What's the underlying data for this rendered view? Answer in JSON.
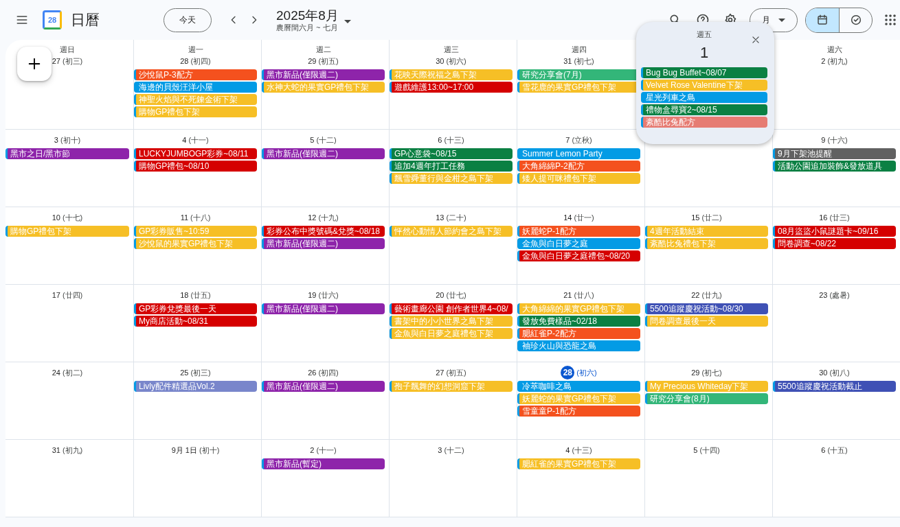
{
  "header": {
    "app_title": "日曆",
    "logo_text": "28",
    "today_button": "今天",
    "title": "2025年8月",
    "subtitle": "農曆閏六月 ~ 七月",
    "view_select": "月",
    "view_toggle": [
      {
        "kind": "calendar",
        "selected": true
      },
      {
        "kind": "tasks",
        "selected": false
      }
    ]
  },
  "weeks": [
    {
      "days": [
        {
          "weekday": "週日",
          "day": "27",
          "lunar": "(初三)"
        },
        {
          "weekday": "週一",
          "day": "28",
          "lunar": "(初四)",
          "events": [
            {
              "title": "沙悅鼠P-3配方",
              "color": "#f4511e"
            },
            {
              "title": "海邊的貝殼汪洋小屋",
              "color": "#039be5"
            },
            {
              "title": "神聖火焰與不死鍊金術下架",
              "color": "#f6bf26"
            },
            {
              "title": "購物GP禮包下架",
              "color": "#f6bf26"
            }
          ]
        },
        {
          "weekday": "週二",
          "day": "29",
          "lunar": "(初五)",
          "events": [
            {
              "title": "黑市新品(僅限週二)",
              "color": "#8e24aa"
            },
            {
              "title": "水神大蛇的果實GP禮包下架",
              "color": "#f6bf26"
            }
          ]
        },
        {
          "weekday": "週三",
          "day": "30",
          "lunar": "(初六)",
          "events": [
            {
              "title": "花映天際祝福之島下架",
              "color": "#f6bf26"
            },
            {
              "title": "遊戲維護13:00~17:00",
              "color": "#d50000"
            }
          ]
        },
        {
          "weekday": "週四",
          "day": "31",
          "lunar": "(初七)",
          "events": [
            {
              "title": "研究分享會(7月)",
              "color": "#33b679"
            },
            {
              "title": "雪花鹿的果實GP禮包下架",
              "color": "#f6bf26"
            }
          ]
        },
        {
          "kind": "covered"
        },
        {
          "weekday": "週六",
          "day": "2",
          "lunar": "(初九)"
        }
      ]
    },
    {
      "days": [
        {
          "day": "3",
          "lunar": "(初十)",
          "events": [
            {
              "title": "黑市之日/黑市節",
              "color": "#8e24aa"
            }
          ]
        },
        {
          "day": "4",
          "lunar": "(十一)",
          "events": [
            {
              "title": "LUCKYJUMBOGP彩券~08/11",
              "color": "#d50000"
            },
            {
              "title": "購物GP禮包~08/10",
              "color": "#d50000"
            }
          ]
        },
        {
          "day": "5",
          "lunar": "(十二)",
          "events": [
            {
              "title": "黑市新品(僅限週二)",
              "color": "#8e24aa"
            }
          ]
        },
        {
          "day": "6",
          "lunar": "(十三)",
          "events": [
            {
              "title": "GP心意袋~08/15",
              "color": "#0b8043"
            },
            {
              "title": "追加4週年打工任務",
              "color": "#0b8043"
            },
            {
              "title": "飄雪舜董行與金柑之島下架",
              "color": "#f6bf26"
            }
          ]
        },
        {
          "day": "7",
          "lunar": "(立秋)",
          "events": [
            {
              "title": "Summer Lemon Party",
              "color": "#039be5"
            },
            {
              "title": "大角綿綿P-2配方",
              "color": "#f4511e"
            },
            {
              "title": "矮人提可咪禮包下架",
              "color": "#f6bf26"
            }
          ]
        },
        {
          "kind": "covered"
        },
        {
          "day": "9",
          "lunar": "(十六)",
          "events": [
            {
              "title": "9月下架池提醒",
              "color": "#616161"
            },
            {
              "title": "活動公園追加裝飾&發放道具",
              "color": "#0b8043"
            }
          ]
        }
      ]
    },
    {
      "days": [
        {
          "day": "10",
          "lunar": "(十七)",
          "events": [
            {
              "title": "購物GP禮包下架",
              "color": "#f6bf26"
            }
          ]
        },
        {
          "day": "11",
          "lunar": "(十八)",
          "events": [
            {
              "title": "GP彩券販售~10:59",
              "color": "#f6bf26"
            },
            {
              "title": "沙悅鼠的果實GP禮包下架",
              "color": "#f6bf26"
            }
          ]
        },
        {
          "day": "12",
          "lunar": "(十九)",
          "events": [
            {
              "title": "彩券公布中獎號碼&兌獎~08/18",
              "color": "#d50000"
            },
            {
              "title": "黑市新品(僅限週二)",
              "color": "#8e24aa"
            }
          ]
        },
        {
          "day": "13",
          "lunar": "(二十)",
          "events": [
            {
              "title": "怦然心動情人節約會之島下架",
              "color": "#f6bf26"
            }
          ]
        },
        {
          "day": "14",
          "lunar": "(廿一)",
          "events": [
            {
              "title": "妖麗蛇P-1配方",
              "color": "#f4511e"
            },
            {
              "title": "金魚與白日夢之庭",
              "color": "#039be5"
            },
            {
              "title": "金魚與白日夢之庭禮包~08/20",
              "color": "#d50000"
            }
          ]
        },
        {
          "day": "15",
          "lunar": "(廿二)",
          "events": [
            {
              "title": "4週年活動結束",
              "color": "#f6bf26"
            },
            {
              "title": "紊酷比兔禮包下架",
              "color": "#f6bf26"
            }
          ]
        },
        {
          "day": "16",
          "lunar": "(廿三)",
          "events": [
            {
              "title": "08月盜盜小鼠謎題卡~09/16",
              "color": "#d50000"
            },
            {
              "title": "問卷調查~08/22",
              "color": "#d50000"
            }
          ]
        }
      ]
    },
    {
      "days": [
        {
          "day": "17",
          "lunar": "(廿四)"
        },
        {
          "day": "18",
          "lunar": "(廿五)",
          "events": [
            {
              "title": "GP彩券兌獎最後一天",
              "color": "#d50000"
            },
            {
              "title": "My商店活動~08/31",
              "color": "#d50000"
            }
          ]
        },
        {
          "day": "19",
          "lunar": "(廿六)",
          "events": [
            {
              "title": "黑市新品(僅限週二)",
              "color": "#8e24aa"
            }
          ]
        },
        {
          "day": "20",
          "lunar": "(廿七)",
          "events": [
            {
              "title": "藝術畫廊公園 創作者世界4~08/",
              "color": "#d50000"
            },
            {
              "title": "書架中的小小世界之島下架",
              "color": "#f6bf26"
            },
            {
              "title": "金魚與白日夢之庭禮包下架",
              "color": "#f6bf26"
            }
          ]
        },
        {
          "day": "21",
          "lunar": "(廿八)",
          "events": [
            {
              "title": "大角綿綿的果實GP禮包下架",
              "color": "#f6bf26"
            },
            {
              "title": "發放免費樣品~02/18",
              "color": "#0b8043"
            },
            {
              "title": "腮紅雀P-2配方",
              "color": "#f4511e"
            },
            {
              "title": "袖珍火山與恐龍之島",
              "color": "#039be5"
            }
          ]
        },
        {
          "day": "22",
          "lunar": "(廿九)",
          "events": [
            {
              "title": "5500追蹤慶祝活動~08/30",
              "color": "#3f51b5"
            },
            {
              "title": "問卷調查最後一天",
              "color": "#f6bf26"
            }
          ]
        },
        {
          "day": "23",
          "lunar": "(處暑)"
        }
      ]
    },
    {
      "days": [
        {
          "day": "24",
          "lunar": "(初二)"
        },
        {
          "day": "25",
          "lunar": "(初三)",
          "events": [
            {
              "title": "Livly配件精選品Vol.2",
              "color": "#7986cb"
            }
          ]
        },
        {
          "day": "26",
          "lunar": "(初四)",
          "events": [
            {
              "title": "黑市新品(僅限週二)",
              "color": "#8e24aa"
            }
          ]
        },
        {
          "day": "27",
          "lunar": "(初五)",
          "events": [
            {
              "title": "孢子飄舞的幻想洞窟下架",
              "color": "#f6bf26"
            }
          ]
        },
        {
          "day": "28",
          "lunar": "(初六)",
          "today": true,
          "events": [
            {
              "title": "冷萃咖啡之島",
              "color": "#039be5"
            },
            {
              "title": "妖麗蛇的果實GP禮包下架",
              "color": "#f6bf26"
            },
            {
              "title": "雪童童P-1配方",
              "color": "#f4511e"
            }
          ]
        },
        {
          "day": "29",
          "lunar": "(初七)",
          "events": [
            {
              "title": "My Precious Whiteday下架",
              "color": "#f6bf26"
            },
            {
              "title": "研究分享會(8月)",
              "color": "#33b679"
            }
          ]
        },
        {
          "day": "30",
          "lunar": "(初八)",
          "events": [
            {
              "title": "5500追蹤慶祝活動截止",
              "color": "#3f51b5"
            }
          ]
        }
      ]
    },
    {
      "days": [
        {
          "day": "31",
          "lunar": "(初九)"
        },
        {
          "day": "9月 1日",
          "lunar": "(初十)"
        },
        {
          "day": "2",
          "lunar": "(十一)",
          "events": [
            {
              "title": "黑市新品(暫定)",
              "color": "#8e24aa"
            }
          ]
        },
        {
          "day": "3",
          "lunar": "(十二)"
        },
        {
          "day": "4",
          "lunar": "(十三)",
          "events": [
            {
              "title": "腮紅雀的果實GP禮包下架",
              "color": "#f6bf26"
            }
          ]
        },
        {
          "day": "5",
          "lunar": "(十四)"
        },
        {
          "day": "6",
          "lunar": "(十五)"
        }
      ]
    }
  ],
  "popup": {
    "weekday": "週五",
    "day": "1",
    "events": [
      {
        "title": "Bug Bug Buffet~08/07",
        "color": "#0b8043"
      },
      {
        "title": "Velvet Rose Valentine下架",
        "color": "#f6bf26"
      },
      {
        "title": "星光列車之島",
        "color": "#039be5"
      },
      {
        "title": "禮物盒尋寶2~08/15",
        "color": "#0b8043"
      },
      {
        "title": "紊酷比兔配方",
        "color": "#e67c73"
      }
    ]
  }
}
